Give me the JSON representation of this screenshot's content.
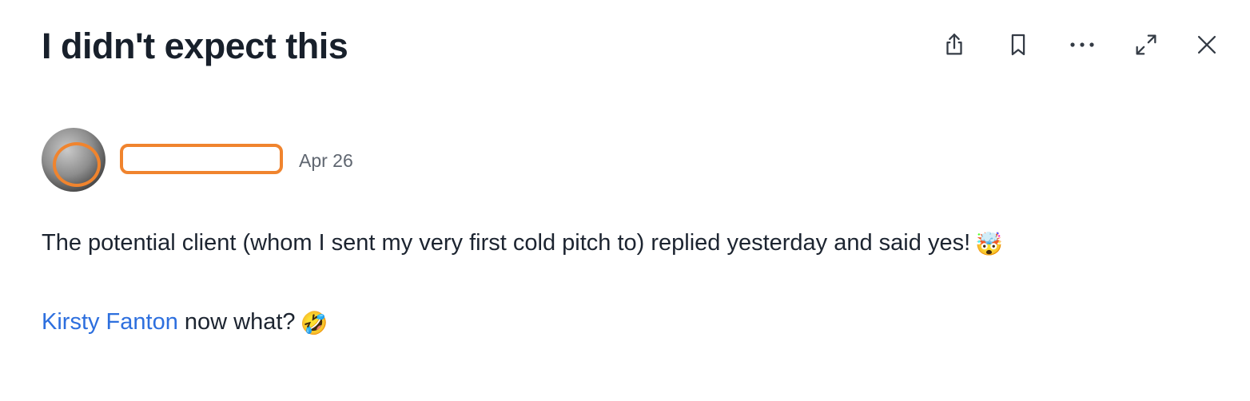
{
  "post": {
    "title": "I didn't expect this",
    "author": {
      "name": "",
      "avatar_alt": "avatar",
      "date": "Apr 26"
    },
    "paragraphs": [
      {
        "text": "The potential client (whom I sent my very first cold pitch to) replied yesterday and said yes!",
        "emoji": "🤯"
      },
      {
        "mention": "Kirsty Fanton",
        "text": " now what?",
        "emoji": "🤣"
      }
    ]
  },
  "toolbar": {
    "icons": [
      "share-icon",
      "bookmark-icon",
      "more-icon",
      "expand-icon",
      "close-icon"
    ]
  },
  "colors": {
    "title": "#18202b",
    "text": "#1c2430",
    "muted": "#5f6670",
    "link": "#2d6fde",
    "annotation": "#f0842e"
  }
}
